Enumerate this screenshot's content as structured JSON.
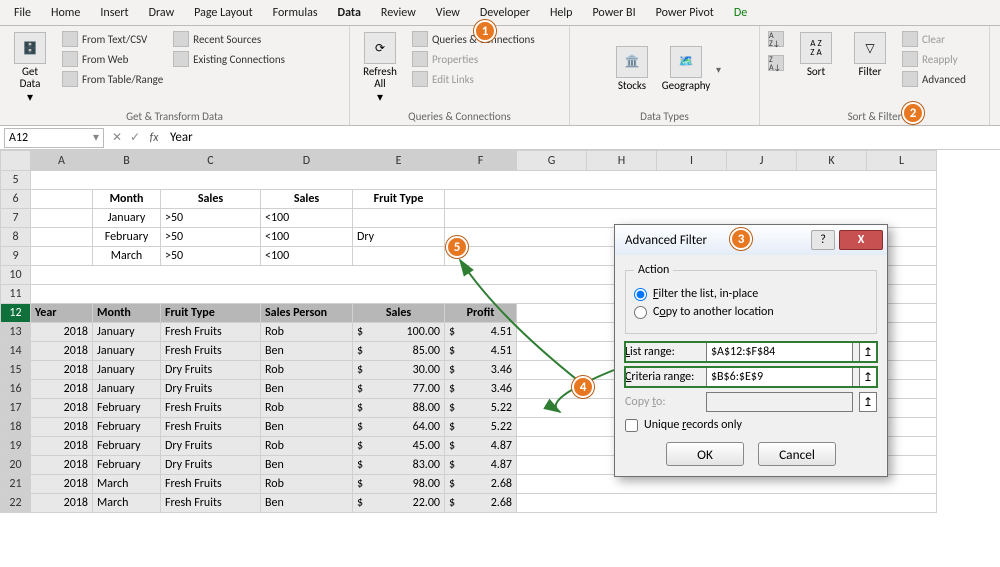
{
  "menubar": {
    "tabs": [
      "File",
      "Home",
      "Insert",
      "Draw",
      "Page Layout",
      "Formulas",
      "Data",
      "Review",
      "View",
      "Developer",
      "Help",
      "Power BI",
      "Power Pivot",
      "De"
    ],
    "active": "Data"
  },
  "ribbon": {
    "groups": {
      "get_transform": {
        "label": "Get & Transform Data",
        "get_data": "Get\nData",
        "items": [
          "From Text/CSV",
          "From Web",
          "From Table/Range",
          "Recent Sources",
          "Existing Connections"
        ]
      },
      "refresh": {
        "label": "Queries & Connections",
        "refresh": "Refresh\nAll",
        "items": [
          "Queries & Connections",
          "Properties",
          "Edit Links"
        ]
      },
      "data_types": {
        "label": "Data Types",
        "stocks": "Stocks",
        "geography": "Geography"
      },
      "sort_filter": {
        "label": "Sort & Filter",
        "sort": "Sort",
        "filter": "Filter",
        "az": "A→Z",
        "za": "Z→A",
        "items": [
          "Clear",
          "Reapply",
          "Advanced"
        ]
      }
    }
  },
  "namebox": "A12",
  "formula": "Year",
  "columns": [
    "A",
    "B",
    "C",
    "D",
    "E",
    "F",
    "G",
    "H",
    "I",
    "J",
    "K",
    "L"
  ],
  "criteria": {
    "headers": [
      "Month",
      "Sales",
      "Sales",
      "Fruit Type"
    ],
    "rows": [
      [
        "January",
        ">50",
        "<100",
        ""
      ],
      [
        "February",
        ">50",
        "<100",
        "Dry"
      ],
      [
        "March",
        ">50",
        "<100",
        ""
      ]
    ]
  },
  "data": {
    "headers": [
      "Year",
      "Month",
      "Fruit Type",
      "Sales Person",
      "Sales",
      "Profit"
    ],
    "rows": [
      [
        "2018",
        "January",
        "Fresh Fruits",
        "Rob",
        "100.00",
        "4.51"
      ],
      [
        "2018",
        "January",
        "Fresh Fruits",
        "Ben",
        "85.00",
        "4.51"
      ],
      [
        "2018",
        "January",
        "Dry Fruits",
        "Rob",
        "30.00",
        "3.46"
      ],
      [
        "2018",
        "January",
        "Dry Fruits",
        "Ben",
        "77.00",
        "3.46"
      ],
      [
        "2018",
        "February",
        "Fresh Fruits",
        "Rob",
        "88.00",
        "5.22"
      ],
      [
        "2018",
        "February",
        "Fresh Fruits",
        "Ben",
        "64.00",
        "5.22"
      ],
      [
        "2018",
        "February",
        "Dry Fruits",
        "Rob",
        "45.00",
        "4.87"
      ],
      [
        "2018",
        "February",
        "Dry Fruits",
        "Ben",
        "83.00",
        "4.87"
      ],
      [
        "2018",
        "March",
        "Fresh Fruits",
        "Rob",
        "98.00",
        "2.68"
      ],
      [
        "2018",
        "March",
        "Fresh Fruits",
        "Ben",
        "22.00",
        "2.68"
      ]
    ]
  },
  "dialog": {
    "title": "Advanced Filter",
    "action_label": "Action",
    "radio1": "Filter the list, in-place",
    "radio2": "Copy to another location",
    "list_label": "List range:",
    "list_value": "$A$12:$F$84",
    "criteria_label": "Criteria range:",
    "criteria_value": "$B$6:$E$9",
    "copy_label": "Copy to:",
    "unique": "Unique records only",
    "ok": "OK",
    "cancel": "Cancel"
  },
  "badges": {
    "b1": "1",
    "b2": "2",
    "b3": "3",
    "b4": "4",
    "b5": "5"
  },
  "icons": {
    "dropdown": "▾",
    "help": "?",
    "close": "X",
    "rangesel": "↥",
    "check": "",
    "dollar": "$"
  }
}
